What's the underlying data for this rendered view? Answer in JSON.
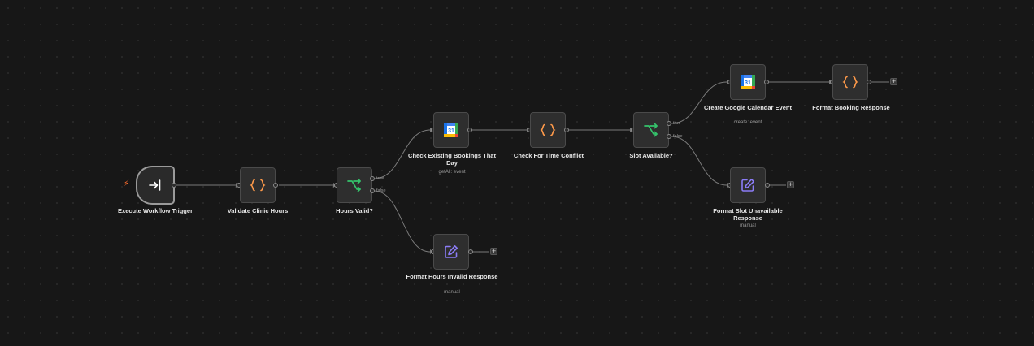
{
  "colors": {
    "canvas": "#171717",
    "node_bg": "#2e2e2e",
    "wire": "#7a7a7a",
    "code_icon": "#ff9a4a",
    "if_icon": "#35c26b",
    "edit_icon": "#8b7cf6",
    "trigger_bolt": "#ff6d2d"
  },
  "nodes": {
    "trigger": {
      "label": "Execute Workflow Trigger",
      "icon": "enter-arrow-icon"
    },
    "validate": {
      "label": "Validate Clinic Hours",
      "icon": "code-braces-icon"
    },
    "hours_valid": {
      "label": "Hours Valid?",
      "icon": "if-branch-icon",
      "true_label": "true",
      "false_label": "false"
    },
    "check_existing": {
      "label": "Check Existing Bookings That Day",
      "sub": "getAll: event",
      "icon": "google-calendar-icon"
    },
    "format_invalid": {
      "label": "Format Hours Invalid Response",
      "sub": "manual",
      "icon": "edit-pencil-icon"
    },
    "check_conflict": {
      "label": "Check For Time Conflict",
      "icon": "code-braces-icon"
    },
    "slot_available": {
      "label": "Slot Available?",
      "icon": "if-branch-icon",
      "true_label": "true",
      "false_label": "false"
    },
    "create_event": {
      "label": "Create Google Calendar Event",
      "sub": "create: event",
      "icon": "google-calendar-icon"
    },
    "format_booking": {
      "label": "Format Booking Response",
      "icon": "code-braces-icon"
    },
    "format_unavailable": {
      "label": "Format Slot Unavailable Response",
      "sub": "manual",
      "icon": "edit-pencil-icon"
    }
  },
  "calendar_day": "31",
  "plus_symbol": "+",
  "bolt_symbol": "⚡"
}
